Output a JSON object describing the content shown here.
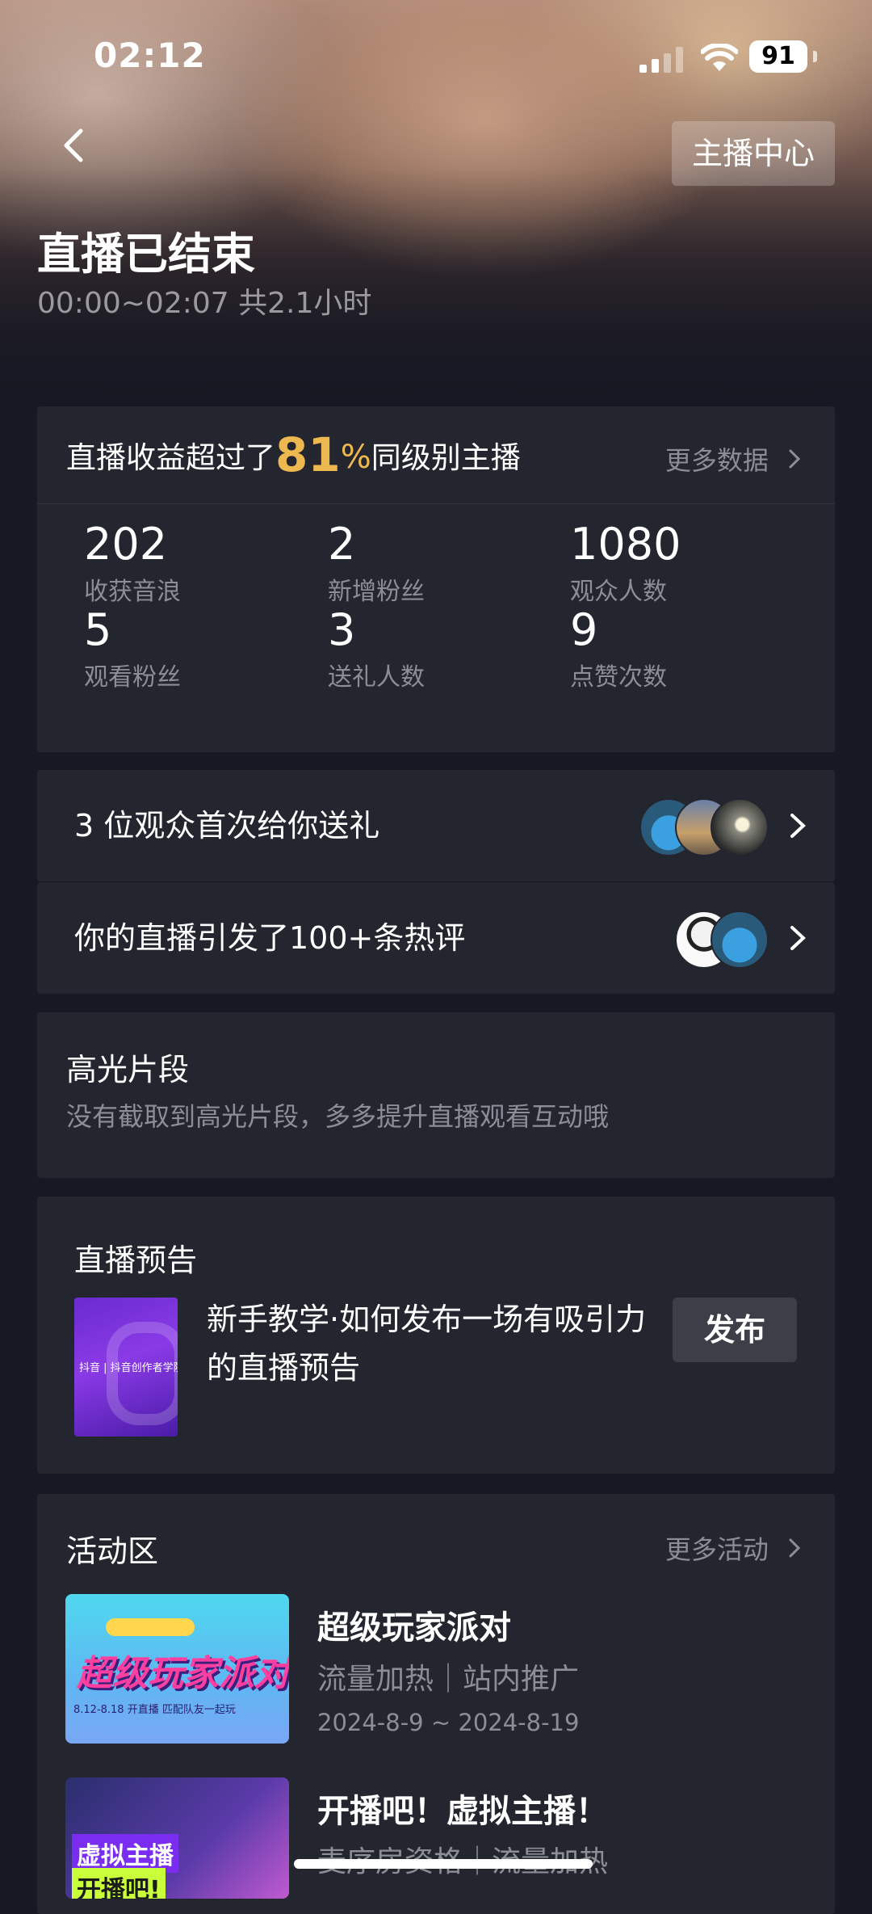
{
  "status_bar": {
    "time": "02:12",
    "battery": "91"
  },
  "header": {
    "anchor_center_label": "主播中心",
    "title": "直播已结束",
    "subtitle": "00:00~02:07 共2.1小时"
  },
  "earnings_card": {
    "prefix": "直播收益超过了",
    "percent_value": "81",
    "percent_sign": "%",
    "suffix": "同级别主播",
    "more_label": "更多数据",
    "stats": [
      {
        "value": "202",
        "label": "收获音浪"
      },
      {
        "value": "2",
        "label": "新增粉丝"
      },
      {
        "value": "1080",
        "label": "观众人数"
      },
      {
        "value": "5",
        "label": "观看粉丝"
      },
      {
        "value": "3",
        "label": "送礼人数"
      },
      {
        "value": "9",
        "label": "点赞次数"
      }
    ]
  },
  "gift_row": {
    "label": "3 位观众首次给你送礼"
  },
  "comment_row": {
    "label": "你的直播引发了100+条热评"
  },
  "highlights": {
    "title": "高光片段",
    "description": "没有截取到高光片段，多多提升直播观看互动哦"
  },
  "preview": {
    "title": "直播预告",
    "thumb_tag": "抖音 | 抖音创作者学院",
    "description": "新手教学·如何发布一场有吸引力的直播预告",
    "publish_label": "发布"
  },
  "activities": {
    "title": "活动区",
    "more_label": "更多活动",
    "items": [
      {
        "title": "超级玩家派对",
        "tags": "流量加热｜站内推广",
        "date": "2024-8-9 ~ 2024-8-19",
        "thumb_text": "超级玩家派对",
        "thumb_small": "8.12-8.18 开直播  匹配队友一起玩"
      },
      {
        "title": "开播吧！虚拟主播！",
        "tags": "麦序房资格｜流量加热",
        "thumb_text": "虚拟主播",
        "thumb_text2": "开播吧!"
      }
    ]
  },
  "colors": {
    "accent": "#ecb84f",
    "card_bg": "#23252f",
    "page_bg": "#171823"
  }
}
